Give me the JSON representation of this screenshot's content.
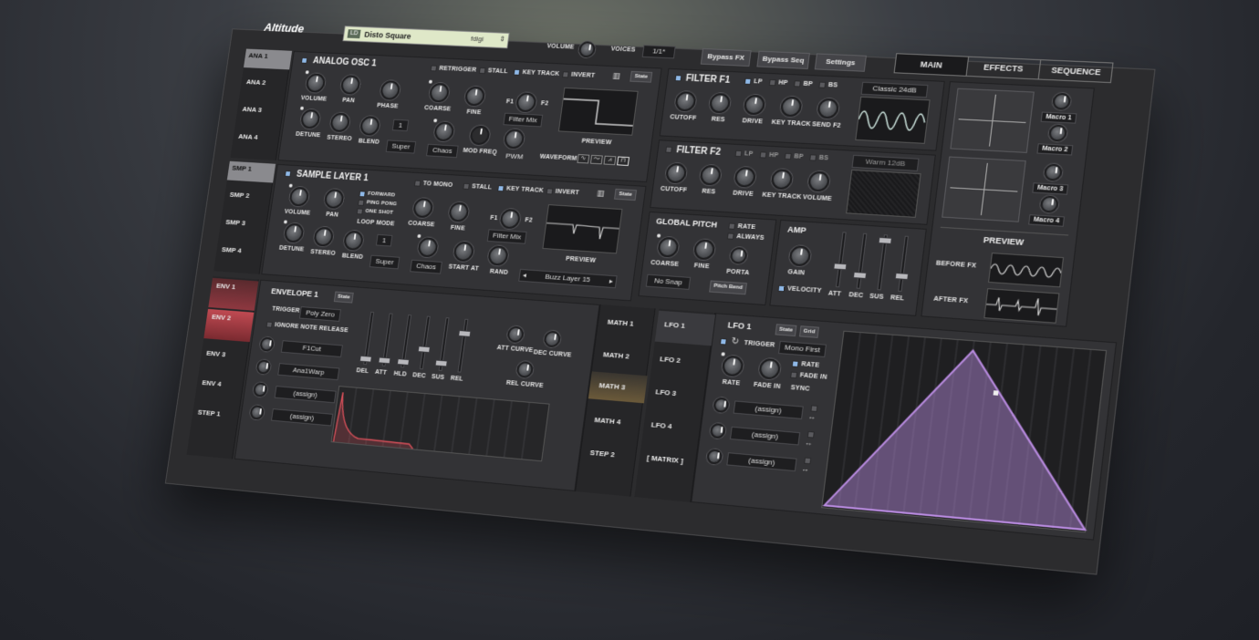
{
  "header": {
    "logo": "Altitude",
    "preset": {
      "badge": "LD",
      "name": "Disto Square",
      "author": "fdigi"
    },
    "volume_label": "VOLUME",
    "voices_label": "VOICES",
    "voices_value": "1/1*",
    "buttons": [
      "Bypass FX",
      "Bypass Seq",
      "Settings"
    ],
    "tabs": [
      "MAIN",
      "EFFECTS",
      "SEQUENCE"
    ],
    "active_tab": "MAIN"
  },
  "osc_tabs": [
    "ANA 1",
    "ANA 2",
    "ANA 3",
    "ANA 4"
  ],
  "osc": {
    "title": "ANALOG OSC 1",
    "toggles": [
      "RETRIGGER",
      "STALL",
      "KEY TRACK",
      "INVERT"
    ],
    "state": "State",
    "knobs_row1": [
      "VOLUME",
      "PAN",
      "PHASE",
      "COARSE",
      "FINE"
    ],
    "knobs_row2": [
      "DETUNE",
      "STEREO",
      "BLEND"
    ],
    "voices_value": "1",
    "super": "Super",
    "chaos": "Chaos",
    "mod_freq": "MOD FREQ",
    "pwm": "PWM",
    "f1": "F1",
    "f2": "F2",
    "filter_mix": "Filter Mix",
    "preview": "PREVIEW",
    "waveform": "WAVEFORM",
    "wave_icons": [
      "∿",
      "〜",
      "⩘",
      "⊓"
    ]
  },
  "smp_tabs": [
    "SMP 1",
    "SMP 2",
    "SMP 3",
    "SMP 4"
  ],
  "sample": {
    "title": "SAMPLE LAYER 1",
    "toggles": [
      "TO MONO",
      "STALL",
      "KEY TRACK",
      "INVERT"
    ],
    "state": "State",
    "knobs_row1": [
      "VOLUME",
      "PAN"
    ],
    "loop_modes": [
      "FORWARD",
      "PING PONG",
      "ONE SHOT"
    ],
    "loop_mode_label": "LOOP MODE",
    "knobs_row1b": [
      "COARSE",
      "FINE"
    ],
    "knobs_row2": [
      "DETUNE",
      "STEREO",
      "BLEND"
    ],
    "voices_value": "1",
    "super": "Super",
    "chaos": "Chaos",
    "start_at": "START AT",
    "rand": "RAND",
    "f1": "F1",
    "f2": "F2",
    "filter_mix": "Filter Mix",
    "preview": "PREVIEW",
    "sample_name": "Buzz Layer 15"
  },
  "filter1": {
    "title": "FILTER F1",
    "types": [
      "LP",
      "HP",
      "BP",
      "BS"
    ],
    "mode": "Classic 24dB",
    "knobs": [
      "CUTOFF",
      "RES",
      "DRIVE",
      "KEY TRACK",
      "SEND F2"
    ]
  },
  "filter2": {
    "title": "FILTER F2",
    "types": [
      "LP",
      "HP",
      "BP",
      "BS"
    ],
    "mode": "Warm 12dB",
    "knobs": [
      "CUTOFF",
      "RES",
      "DRIVE",
      "KEY TRACK",
      "VOLUME"
    ]
  },
  "pitch": {
    "title": "GLOBAL PITCH",
    "options": [
      "RATE",
      "ALWAYS"
    ],
    "knobs": [
      "COARSE",
      "FINE",
      "PORTA"
    ],
    "snap": "No Snap",
    "pitch_bend": "Pitch Bend"
  },
  "amp": {
    "title": "AMP",
    "gain": "GAIN",
    "velocity": "VELOCITY",
    "faders": [
      "ATT",
      "DEC",
      "SUS",
      "REL"
    ],
    "levels": [
      0.35,
      0.2,
      0.95,
      0.25
    ]
  },
  "macros": {
    "labels": [
      "Macro 1",
      "Macro 2",
      "Macro 3",
      "Macro 4"
    ],
    "preview": "PREVIEW",
    "before_fx": "BEFORE FX",
    "after_fx": "AFTER FX"
  },
  "env_tabs": [
    "ENV 1",
    "ENV 2",
    "ENV 3",
    "ENV 4",
    "STEP 1"
  ],
  "envelope": {
    "title": "ENVELOPE 1",
    "state": "State",
    "trigger_label": "TRIGGER",
    "trigger_value": "Poly Zero",
    "ignore_release": "IGNORE NOTE RELEASE",
    "mod_targets": [
      "F1Cut",
      "Ana1Warp",
      "(assign)",
      "(assign)"
    ],
    "faders": [
      "DEL",
      "ATT",
      "HLD",
      "DEC",
      "SUS",
      "REL"
    ],
    "levels": [
      0.05,
      0.05,
      0.05,
      0.35,
      0.1,
      0.75
    ],
    "curves": [
      "ATT CURVE",
      "DEC CURVE",
      "REL CURVE"
    ]
  },
  "math_tabs": [
    "MATH 1",
    "MATH 2",
    "MATH 3",
    "MATH 4",
    "STEP 2"
  ],
  "lfo_tabs": [
    "LFO 1",
    "LFO 2",
    "LFO 3",
    "LFO 4",
    "[ MATRIX ]"
  ],
  "lfo": {
    "title": "LFO 1",
    "state": "State",
    "grid": "Grid",
    "trigger_label": "TRIGGER",
    "trigger_value": "Mono First",
    "knobs": [
      "RATE",
      "FADE IN"
    ],
    "options": [
      "RATE",
      "FADE IN"
    ],
    "sync": "SYNC",
    "mod_targets": [
      "(assign)",
      "(assign)",
      "(assign)"
    ],
    "arrow": "↔"
  },
  "colors": {
    "accent_purple": "#b98be0",
    "accent_red": "#d9505a",
    "screen_green": "#dfe8c8",
    "checkbox_blue": "#8fb9e8"
  }
}
